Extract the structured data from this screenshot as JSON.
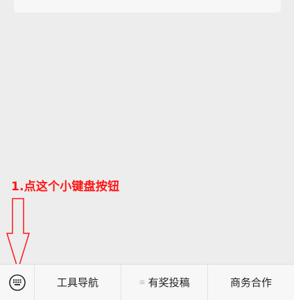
{
  "annotation": {
    "text": "1.点这个小键盘按钮"
  },
  "keyboard": {
    "icon": "keyboard-icon"
  },
  "menu": [
    {
      "label": "工具导航",
      "has_submenu": false
    },
    {
      "label": "有奖投稿",
      "has_submenu": true,
      "icon": "menu-lines-icon"
    },
    {
      "label": "商务合作",
      "has_submenu": false
    }
  ],
  "colors": {
    "background": "#ededed",
    "bar": "#f7f7f7",
    "annotation_red": "#ff1616"
  }
}
